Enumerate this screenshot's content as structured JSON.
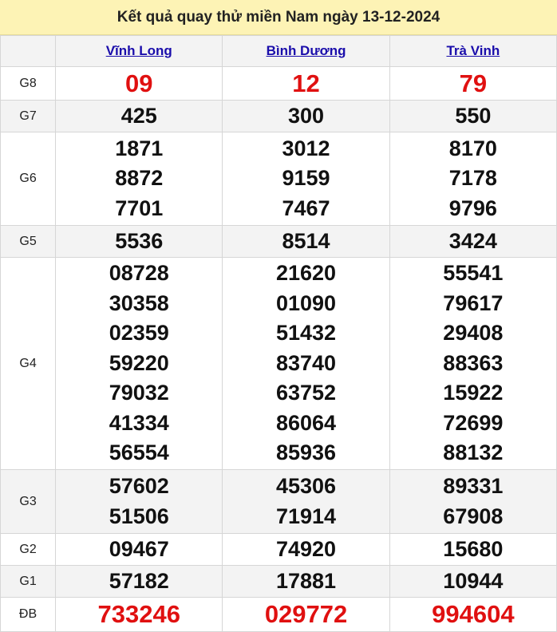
{
  "title": "Kết quả quay thử miền Nam ngày 13-12-2024",
  "provinces": [
    "Vĩnh Long",
    "Bình Dương",
    "Trà Vinh"
  ],
  "prizes": [
    {
      "label": "G8",
      "values": [
        [
          "09"
        ],
        [
          "12"
        ],
        [
          "79"
        ]
      ]
    },
    {
      "label": "G7",
      "values": [
        [
          "425"
        ],
        [
          "300"
        ],
        [
          "550"
        ]
      ]
    },
    {
      "label": "G6",
      "values": [
        [
          "1871",
          "8872",
          "7701"
        ],
        [
          "3012",
          "9159",
          "7467"
        ],
        [
          "8170",
          "7178",
          "9796"
        ]
      ]
    },
    {
      "label": "G5",
      "values": [
        [
          "5536"
        ],
        [
          "8514"
        ],
        [
          "3424"
        ]
      ]
    },
    {
      "label": "G4",
      "values": [
        [
          "08728",
          "30358",
          "02359",
          "59220",
          "79032",
          "41334",
          "56554"
        ],
        [
          "21620",
          "01090",
          "51432",
          "83740",
          "63752",
          "86064",
          "85936"
        ],
        [
          "55541",
          "79617",
          "29408",
          "88363",
          "15922",
          "72699",
          "88132"
        ]
      ]
    },
    {
      "label": "G3",
      "values": [
        [
          "57602",
          "51506"
        ],
        [
          "45306",
          "71914"
        ],
        [
          "89331",
          "67908"
        ]
      ]
    },
    {
      "label": "G2",
      "values": [
        [
          "09467"
        ],
        [
          "74920"
        ],
        [
          "15680"
        ]
      ]
    },
    {
      "label": "G1",
      "values": [
        [
          "57182"
        ],
        [
          "17881"
        ],
        [
          "10944"
        ]
      ]
    },
    {
      "label": "ĐB",
      "values": [
        [
          "733246"
        ],
        [
          "029772"
        ],
        [
          "994604"
        ]
      ]
    }
  ],
  "colors": {
    "highlight": "#e01010",
    "link": "#1a0dab",
    "title_bg": "#fdf3b5"
  }
}
